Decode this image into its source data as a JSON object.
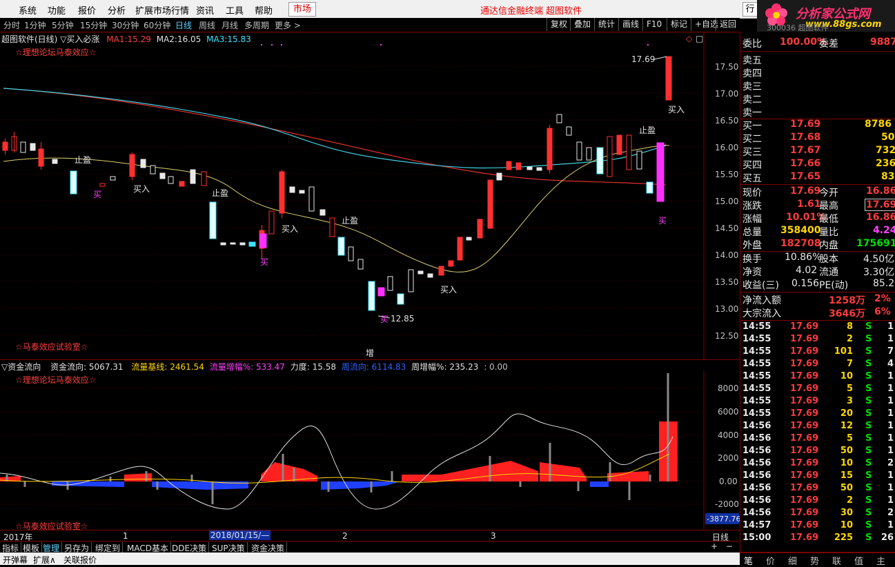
{
  "menu": {
    "items": [
      "系统",
      "功能",
      "报价",
      "分析",
      "扩展市场行情",
      "资讯",
      "工具",
      "帮助"
    ],
    "market_button": "市场",
    "center_title": "通达信金融终端  超图软件",
    "right_button": "行",
    "logo_text": "分析家公式网",
    "logo_url": "www.88gs.com",
    "logo_sub": "300036 超图软件"
  },
  "periods": [
    "分时",
    "1分钟",
    "5分钟",
    "15分钟",
    "30分钟",
    "60分钟",
    "日线",
    "周线",
    "月线",
    "多周期",
    "更多 >"
  ],
  "active_period": "日线",
  "tools": [
    "复权",
    "叠加",
    "统计",
    "画线",
    "F10",
    "标记",
    "+自选",
    "返回"
  ],
  "main_chart": {
    "header": {
      "name": "超图软件(日线)",
      "indicator": "▽买入必涨",
      "ma1_label": "MA1:",
      "ma1": "15.29",
      "ma2_label": "MA2:",
      "ma2": "16.05",
      "ma3_label": "MA3:",
      "ma3": "15.83"
    },
    "watermark_top": "☆理想论坛马泰效应☆",
    "watermark_bottom": "☆马泰效应试验室☆",
    "y_ticks": [
      "17.50",
      "17.00",
      "16.50",
      "16.00",
      "15.50",
      "15.00",
      "14.50",
      "14.00",
      "13.50",
      "13.00",
      "12.50"
    ],
    "max_label": "17.69",
    "min_label": "12.85",
    "zeng_label": "增",
    "signals": [
      {
        "text": "止盈",
        "color": "white"
      },
      {
        "text": "买",
        "color": "mag"
      },
      {
        "text": "买入",
        "color": "white"
      },
      {
        "text": "止盈",
        "color": "white"
      },
      {
        "text": "买入",
        "color": "white"
      },
      {
        "text": "买",
        "color": "mag"
      },
      {
        "text": "止盈",
        "color": "white"
      },
      {
        "text": "买",
        "color": "mag"
      },
      {
        "text": "买入",
        "color": "white"
      },
      {
        "text": "止盈",
        "color": "white"
      },
      {
        "text": "买入",
        "color": "white"
      },
      {
        "text": "买",
        "color": "mag"
      }
    ]
  },
  "sub_chart": {
    "header": {
      "name": "▽资金流向",
      "f1": "资金流向: 5067.31",
      "f2": "流量基线: 2461.54",
      "f3": "流量增幅%: 533.47",
      "f4": "力度: 15.58",
      "f5": "周流向: 6114.83",
      "f6": "周增幅%: 235.23",
      "f7": ": 0.00"
    },
    "watermark_top": "☆理想论坛马泰效应☆",
    "watermark_bottom": "☆马泰效应试验室☆",
    "y_ticks": [
      "8000",
      "6000",
      "4000",
      "2000",
      "0.00",
      "-2000"
    ],
    "cursor_value": "-3877.76"
  },
  "time_axis": {
    "labels": [
      "2017年",
      "1",
      "2018/01/15/—",
      "2",
      "3"
    ],
    "period_btn": "日线"
  },
  "bottom_tabs": [
    "指标",
    "模板",
    "管理",
    "另存为",
    "绑定到",
    "MACD基本",
    "DDE决策",
    "SUP决策",
    "资金决策"
  ],
  "active_tab": "管理",
  "status": [
    "开弹幕",
    "扩展∧",
    "关联报价"
  ],
  "quote": {
    "wb_label": "委比",
    "wb": "100.00%",
    "wc_label": "委差",
    "wc": "9887",
    "sells": [
      "卖五",
      "卖四",
      "卖三",
      "卖二",
      "卖一"
    ],
    "buys": [
      {
        "l": "买一",
        "p": "17.69",
        "v": "8786"
      },
      {
        "l": "买二",
        "p": "17.68",
        "v": "50"
      },
      {
        "l": "买三",
        "p": "17.67",
        "v": "732"
      },
      {
        "l": "买四",
        "p": "17.66",
        "v": "236"
      },
      {
        "l": "买五",
        "p": "17.65",
        "v": "83"
      }
    ],
    "stats": [
      {
        "l1": "现价",
        "v1": "17.69",
        "c1": "red",
        "l2": "今开",
        "v2": "16.86",
        "c2": "red"
      },
      {
        "l1": "涨跌",
        "v1": "1.61",
        "c1": "red",
        "l2": "最高",
        "v2": "17.69",
        "c2": "red"
      },
      {
        "l1": "涨幅",
        "v1": "10.01%",
        "c1": "red",
        "l2": "最低",
        "v2": "16.86",
        "c2": "red"
      },
      {
        "l1": "总量",
        "v1": "358400",
        "c1": "yellow",
        "l2": "量比",
        "v2": "4.24",
        "c2": "mag"
      },
      {
        "l1": "外盘",
        "v1": "182708",
        "c1": "red",
        "l2": "内盘",
        "v2": "175691",
        "c2": "green"
      },
      {
        "l1": "换手",
        "v1": "10.86%",
        "c1": "white",
        "l2": "股本",
        "v2": "4.50亿",
        "c2": "white"
      },
      {
        "l1": "净资",
        "v1": "4.02",
        "c1": "white",
        "l2": "流通",
        "v2": "3.30亿",
        "c2": "white"
      },
      {
        "l1": "收益(三)",
        "v1": "0.156",
        "c1": "white",
        "l2": "PE(动)",
        "v2": "85.2",
        "c2": "white"
      }
    ],
    "flows": [
      {
        "l": "净流入额",
        "v": "1258万",
        "p": "2%"
      },
      {
        "l": "大宗流入",
        "v": "3646万",
        "p": "6%"
      }
    ],
    "ticks": [
      [
        "14:55",
        "17.69",
        "8",
        "S",
        "1"
      ],
      [
        "14:55",
        "17.69",
        "2",
        "S",
        "1"
      ],
      [
        "14:55",
        "17.69",
        "101",
        "S",
        "7"
      ],
      [
        "14:55",
        "17.69",
        "7",
        "S",
        "4"
      ],
      [
        "14:55",
        "17.69",
        "10",
        "S",
        "1"
      ],
      [
        "14:55",
        "17.69",
        "5",
        "S",
        "1"
      ],
      [
        "14:55",
        "17.69",
        "3",
        "S",
        "1"
      ],
      [
        "14:55",
        "17.69",
        "20",
        "S",
        "1"
      ],
      [
        "14:56",
        "17.69",
        "12",
        "S",
        "1"
      ],
      [
        "14:56",
        "17.69",
        "5",
        "S",
        "1"
      ],
      [
        "14:56",
        "17.69",
        "50",
        "S",
        "1"
      ],
      [
        "14:56",
        "17.69",
        "10",
        "S",
        "2"
      ],
      [
        "14:56",
        "17.69",
        "15",
        "S",
        "1"
      ],
      [
        "14:56",
        "17.69",
        "50",
        "S",
        "1"
      ],
      [
        "14:56",
        "17.69",
        "2",
        "S",
        "1"
      ],
      [
        "14:56",
        "17.69",
        "30",
        "S",
        "2"
      ],
      [
        "14:57",
        "17.69",
        "10",
        "S",
        "1"
      ],
      [
        "15:00",
        "17.69",
        "225",
        "S",
        "26"
      ]
    ],
    "tabs": [
      "笔",
      "价",
      "细",
      "势",
      "联",
      "值",
      "主"
    ]
  }
}
